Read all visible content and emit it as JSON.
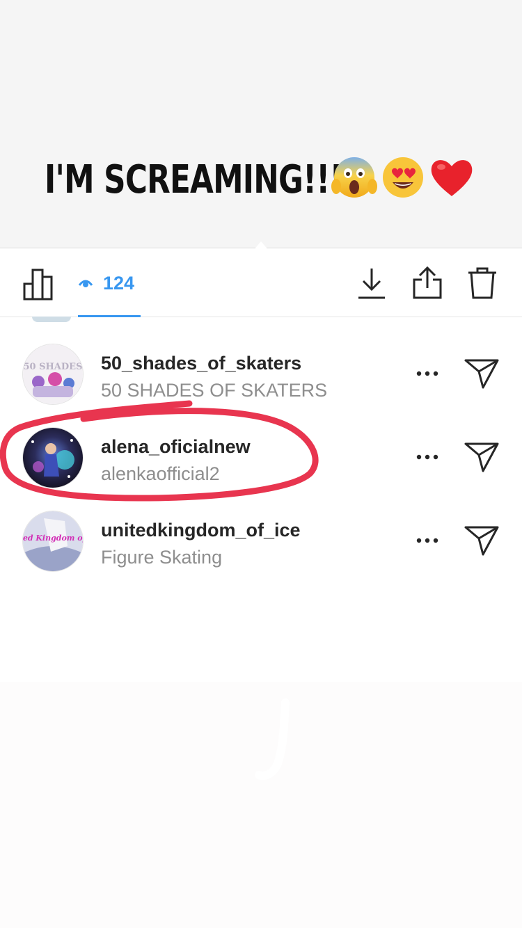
{
  "story": {
    "caption": "I'M SCREAMING!!!!",
    "emojis": [
      "face-screaming-in-fear",
      "smiling-face-with-heart-eyes",
      "red-heart"
    ]
  },
  "toolbar": {
    "view_count": "124",
    "accent_color": "#3897f0",
    "icons": [
      "insights-icon",
      "eye-icon",
      "download-icon",
      "share-icon",
      "trash-icon"
    ]
  },
  "viewers": [
    {
      "username": "50_shades_of_skaters",
      "full_name": "50 SHADES OF SKATERS",
      "avatar_text": "50 SHADES"
    },
    {
      "username": "alena_oficialnew",
      "full_name": "alenkaofficial2",
      "highlighted": true
    },
    {
      "username": "unitedkingdom_of_ice",
      "full_name": "Figure Skating",
      "avatar_text": "United Kingdom of Ice"
    }
  ],
  "highlight_color": "#e8354f"
}
